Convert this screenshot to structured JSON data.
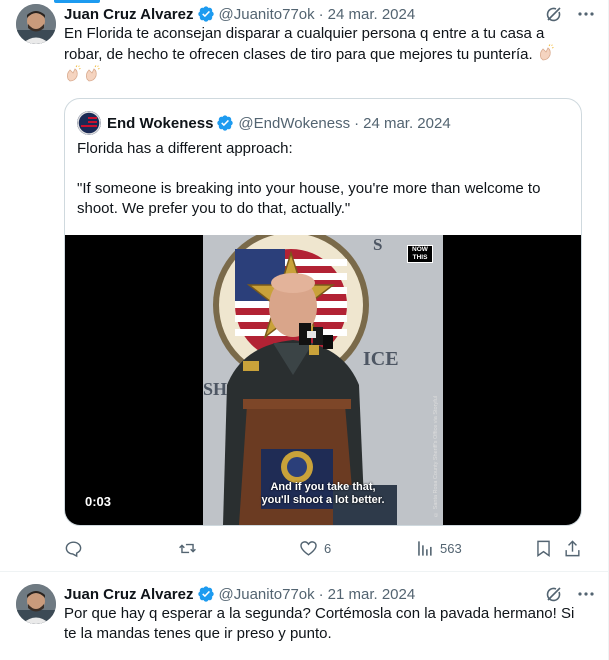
{
  "tweets": [
    {
      "author_name": "Juan Cruz Alvarez",
      "handle": "@Juanito77ok",
      "separator": "·",
      "date": "24 mar. 2024",
      "text_line1": "En Florida te aconsejan disparar a cualquier persona q entre a tu casa a",
      "text_line2": "robar,  de hecho te ofrecen clases de tiro para que mejores tu puntería.",
      "emojis": [
        "clapping-hands",
        "clapping-hands",
        "clapping-hands"
      ],
      "quote": {
        "author_name": "End Wokeness",
        "handle": "@EndWokeness",
        "separator": "·",
        "date": "24 mar. 2024",
        "text_line1": "Florida has a different approach:",
        "text_line2": "\"If someone is breaking into your house, you're more than welcome to",
        "text_line3": "shoot. We prefer you to do that, actually.\"",
        "video": {
          "time": "0:03",
          "caption_line1": "And if you take that,",
          "caption_line2": "you'll shoot a lot better.",
          "logo_line1": "NOW",
          "logo_line2": "THIS",
          "credit": "© Santa Rosa County Sheriff's Office via Storyful"
        }
      },
      "actions": {
        "reply_count": "",
        "retweet_count": "",
        "like_count": "6",
        "views_count": "563"
      }
    },
    {
      "author_name": "Juan Cruz Alvarez",
      "handle": "@Juanito77ok",
      "separator": "·",
      "date": "21 mar. 2024",
      "text_line1": "Por que hay q esperar a la segunda? Cortémosla con la pavada hermano! Si",
      "text_line2": "te la mandas tenes que ir preso y punto."
    }
  ],
  "colors": {
    "text": "#0f1419",
    "secondary": "#536471",
    "accent": "#1d9bf0",
    "border": "#cfd9de"
  },
  "icons": [
    "verified-badge-icon",
    "grok-icon",
    "more-icon",
    "reply-icon",
    "retweet-icon",
    "like-icon",
    "views-icon",
    "bookmark-icon",
    "share-icon"
  ]
}
